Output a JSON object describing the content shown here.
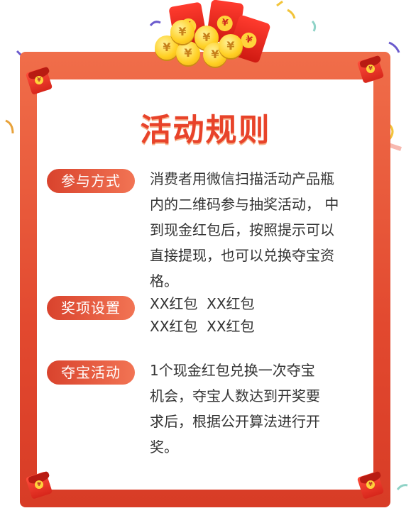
{
  "title": "活动规则",
  "colors": {
    "frame": "#e2492f",
    "tag_start": "#d9432d",
    "tag_end": "#f27454",
    "title": "#e8432a",
    "text": "#333333"
  },
  "decorations": {
    "yen_symbol": "¥"
  },
  "sections": [
    {
      "tag": "参与方式",
      "lines": [
        "消费者用微信扫描活动产品瓶",
        "内的二维码参与抽奖活动， 中",
        "到现金红包后，按照提示可以",
        "直接提现，也可以兑换夺宝资",
        "格。"
      ]
    },
    {
      "tag": "奖项设置",
      "lines": [
        "XX红包  XX红包",
        "XX红包  XX红包"
      ]
    },
    {
      "tag": "夺宝活动",
      "lines": [
        "1个现金红包兑换一次夺宝",
        "机会，夺宝人数达到开奖要",
        "求后，根据公开算法进行开",
        "奖。"
      ]
    }
  ]
}
